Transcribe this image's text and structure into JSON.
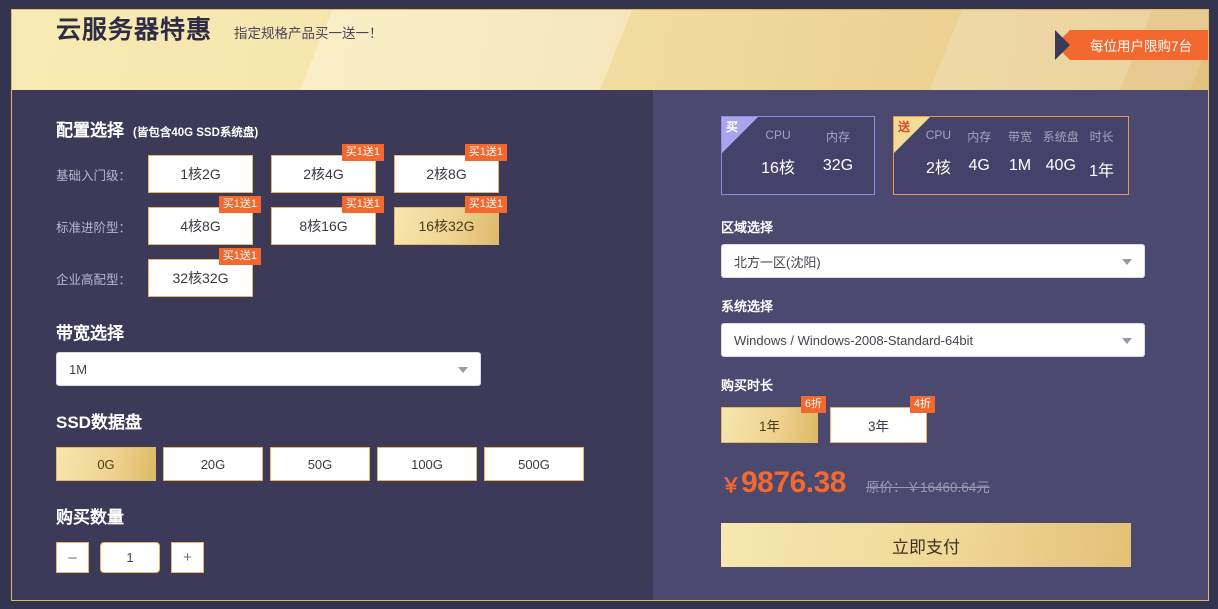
{
  "header": {
    "title": "云服务器特惠",
    "subtitle": "指定规格产品买一送一！",
    "ribbon": "每位用户限购7台"
  },
  "left": {
    "config": {
      "title": "配置选择",
      "note": "(皆包含40G SSD系统盘)",
      "rows": [
        {
          "label": "基础入门级：",
          "options": [
            {
              "label": "1核2G",
              "tag": "",
              "selected": false
            },
            {
              "label": "2核4G",
              "tag": "买1送1",
              "selected": false
            },
            {
              "label": "2核8G",
              "tag": "买1送1",
              "selected": false
            }
          ]
        },
        {
          "label": "标准进阶型：",
          "options": [
            {
              "label": "4核8G",
              "tag": "买1送1",
              "selected": false
            },
            {
              "label": "8核16G",
              "tag": "买1送1",
              "selected": false
            },
            {
              "label": "16核32G",
              "tag": "买1送1",
              "selected": true
            }
          ]
        },
        {
          "label": "企业高配型：",
          "options": [
            {
              "label": "32核32G",
              "tag": "买1送1",
              "selected": false
            }
          ]
        }
      ]
    },
    "bandwidth": {
      "title": "带宽选择",
      "value": "1M",
      "caret": "chevron-down-icon"
    },
    "ssd": {
      "title": "SSD数据盘",
      "options": [
        {
          "label": "0G",
          "selected": true
        },
        {
          "label": "20G",
          "selected": false
        },
        {
          "label": "50G",
          "selected": false
        },
        {
          "label": "100G",
          "selected": false
        },
        {
          "label": "500G",
          "selected": false
        }
      ]
    },
    "quantity": {
      "title": "购买数量",
      "minus": "–",
      "value": "1",
      "plus": "+"
    }
  },
  "right": {
    "buy_card": {
      "corner": "买",
      "columns": [
        {
          "head": "CPU",
          "value": "16核"
        },
        {
          "head": "内存",
          "value": "32G"
        }
      ]
    },
    "gift_card": {
      "corner": "送",
      "columns": [
        {
          "head": "CPU",
          "value": "2核"
        },
        {
          "head": "内存",
          "value": "4G"
        },
        {
          "head": "带宽",
          "value": "1M"
        },
        {
          "head": "系统盘",
          "value": "40G"
        },
        {
          "head": "时长",
          "value": "1年"
        }
      ]
    },
    "region": {
      "title": "区域选择",
      "value": "北方一区(沈阳)"
    },
    "system": {
      "title": "系统选择",
      "value": "Windows / Windows-2008-Standard-64bit"
    },
    "duration": {
      "title": "购买时长",
      "options": [
        {
          "label": "1年",
          "tag": "6折",
          "selected": true
        },
        {
          "label": "3年",
          "tag": "4折",
          "selected": false
        }
      ]
    },
    "price": {
      "currency": "￥",
      "amount": "9876.38",
      "original": "原价：￥16460.64元"
    },
    "pay_button": "立即支付"
  },
  "colors": {
    "accent_orange": "#f3682f",
    "gold": "#e8b765",
    "panel_left": "#3c3a58",
    "panel_right": "#4b4970"
  }
}
